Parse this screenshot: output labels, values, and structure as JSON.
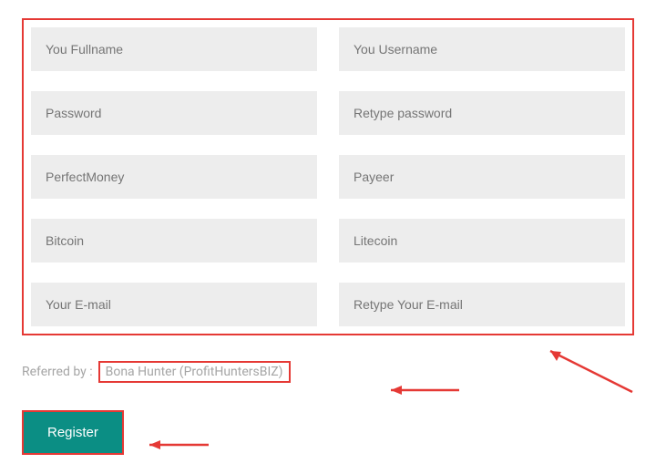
{
  "form": {
    "fullname": {
      "placeholder": "You Fullname"
    },
    "username": {
      "placeholder": "You Username"
    },
    "password": {
      "placeholder": "Password"
    },
    "retype_password": {
      "placeholder": "Retype password"
    },
    "perfectmoney": {
      "placeholder": "PerfectMoney"
    },
    "payeer": {
      "placeholder": "Payeer"
    },
    "bitcoin": {
      "placeholder": "Bitcoin"
    },
    "litecoin": {
      "placeholder": "Litecoin"
    },
    "email": {
      "placeholder": "Your E-mail"
    },
    "retype_email": {
      "placeholder": "Retype Your E-mail"
    }
  },
  "referral": {
    "label": "Referred by :",
    "value": "Bona Hunter (ProfitHuntersBIZ)"
  },
  "actions": {
    "register_label": "Register"
  }
}
